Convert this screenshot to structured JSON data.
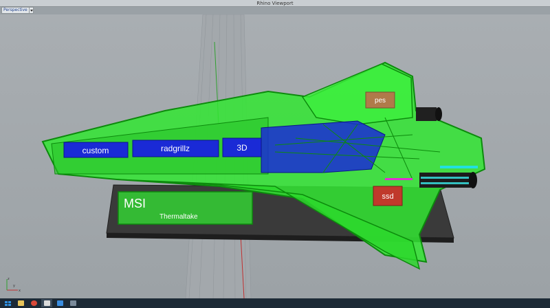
{
  "window": {
    "title": "Rhino Viewport"
  },
  "viewport": {
    "tab_label": "Perspective"
  },
  "model_labels": {
    "custom": "custom",
    "radgrillz": "radgrillz",
    "three_d": "3D",
    "pes": "pes",
    "ssd": "ssd",
    "msi": "MSI",
    "thermaltake": "Thermaltake"
  },
  "axis": {
    "x": "x",
    "y": "y",
    "z": "z"
  },
  "colors": {
    "hull_green": "#33e633",
    "hull_outline": "#0c8a0c",
    "panel_blue": "#1a2ad6",
    "pes_brown": "#b07a4a",
    "ssd_red": "#c0392b",
    "base_dark": "#3a3a3a",
    "taskbar": "#1d2a36"
  },
  "taskbar": {
    "icons": [
      "windows-start-icon",
      "file-explorer-icon",
      "browser-icon",
      "rhino-icon",
      "app-blue-icon",
      "app-gray-icon"
    ]
  }
}
